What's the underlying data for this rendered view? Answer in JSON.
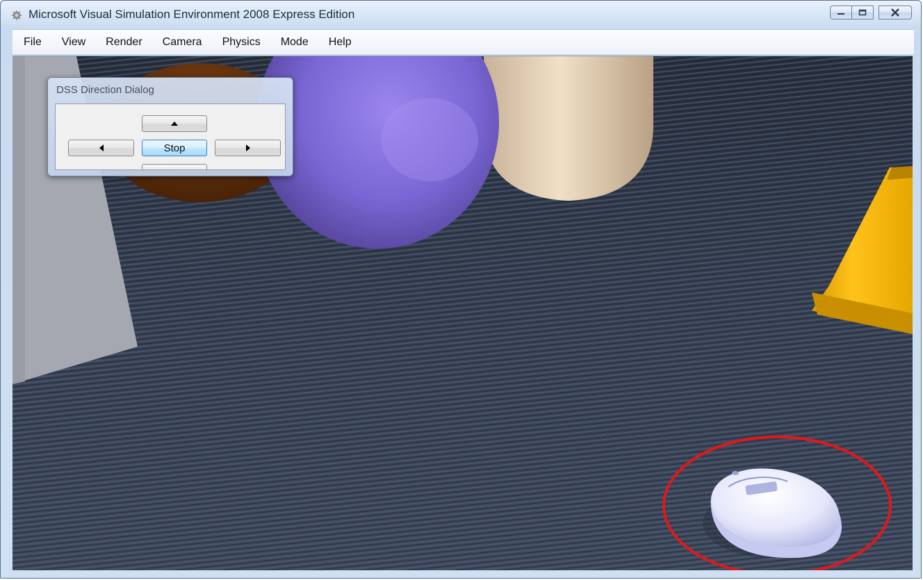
{
  "window": {
    "title": "Microsoft Visual Simulation Environment 2008 Express Edition"
  },
  "menu": {
    "items": [
      "File",
      "View",
      "Render",
      "Camera",
      "Physics",
      "Mode",
      "Help"
    ]
  },
  "dialog": {
    "title": "DSS Direction Dialog",
    "stop_label": "Stop",
    "icons": {
      "up": "arrow-up-icon",
      "left": "arrow-left-icon",
      "right": "arrow-right-icon"
    }
  },
  "scene": {
    "colors": {
      "floor": "#323b4b",
      "sphere": "#8a6fe0",
      "cone": "#f4b400",
      "highlight": "#e0181b",
      "robot": "#e8ebff"
    }
  }
}
